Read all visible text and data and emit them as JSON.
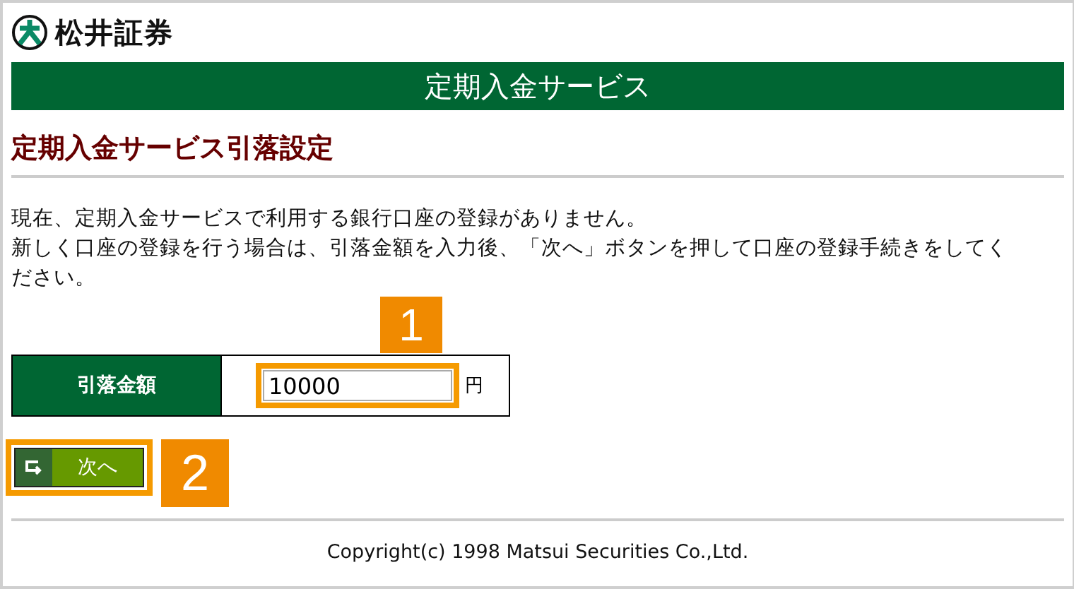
{
  "header": {
    "brand": "松井証券"
  },
  "banner": {
    "title": "定期入金サービス"
  },
  "page_title": "定期入金サービス引落設定",
  "message": [
    "現在、定期入金サービスで利用する銀行口座の登録がありません。",
    "新しく口座の登録を行う場合は、引落金額を入力後、「次へ」ボタンを押して口座の登録手続きをしてください。"
  ],
  "form": {
    "label": "引落金額",
    "value": "10000",
    "unit": "円",
    "highlighted": true
  },
  "next_button": {
    "label": "次へ",
    "highlighted": true
  },
  "annotations": [
    {
      "label": "1"
    },
    {
      "label": "2"
    }
  ],
  "footer": {
    "copyright": "Copyright(c) 1998 Matsui Securities Co.,Ltd."
  }
}
